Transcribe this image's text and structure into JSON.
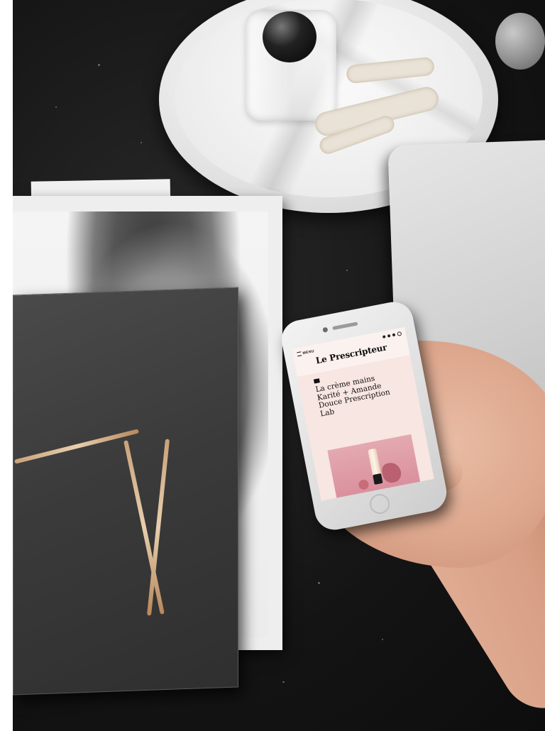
{
  "phone_site": {
    "menu_label": "MENU",
    "logo": "Le Prescripteur",
    "tagline": "",
    "category": "",
    "article_title": "La crème mains Karité + Amande Douce Prescription Lab",
    "meta_left": "",
    "meta_right": "",
    "image_alt": "pink product shot of hand cream tube"
  },
  "colors": {
    "screen_bg": "#f7e6e1",
    "tag_bg": "#111111",
    "image_pink": "#e4a9b1"
  },
  "icons": [
    "menu-icon",
    "search-icon"
  ]
}
